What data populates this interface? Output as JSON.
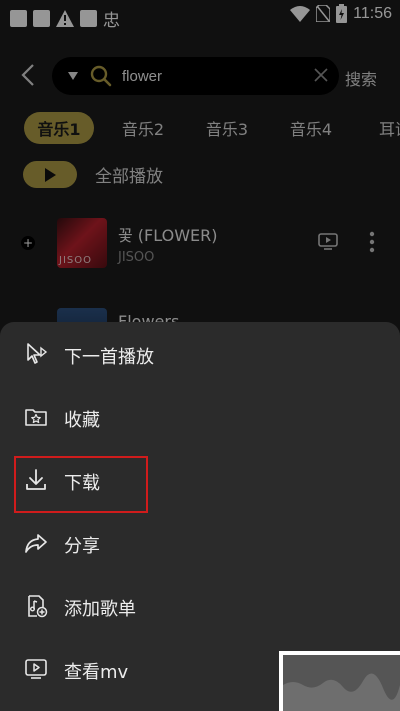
{
  "status_bar": {
    "time": "11:56",
    "icons": [
      "notification-square-icon",
      "notification-square-icon",
      "warning-icon",
      "notification-square-icon",
      "app-glyph-icon",
      "wifi-icon",
      "no-sim-icon",
      "battery-charging-icon"
    ],
    "app_glyph": "忠"
  },
  "search": {
    "query": "flower",
    "button_label": "搜索"
  },
  "tabs": [
    "音乐1",
    "音乐2",
    "音乐3",
    "音乐4",
    "耳语"
  ],
  "active_tab": 0,
  "play_all": {
    "label": "全部播放"
  },
  "songs": [
    {
      "title": "꽃 (FLOWER)",
      "artist": "JISOO",
      "cover_text": "JISOO"
    },
    {
      "title": "Flowers",
      "artist": ""
    }
  ],
  "menu": {
    "items": [
      {
        "label": "下一首播放",
        "icon": "play-next-icon"
      },
      {
        "label": "收藏",
        "icon": "favorite-folder-icon"
      },
      {
        "label": "下载",
        "icon": "download-icon"
      },
      {
        "label": "分享",
        "icon": "share-icon"
      },
      {
        "label": "添加歌单",
        "icon": "add-playlist-icon"
      },
      {
        "label": "查看mv",
        "icon": "mv-icon"
      }
    ],
    "highlighted_index": 2
  },
  "colors": {
    "accent": "#a79543",
    "background": "#1b1b1b",
    "sheet": "#2b2b2b",
    "highlight_border": "#d01c1c"
  }
}
